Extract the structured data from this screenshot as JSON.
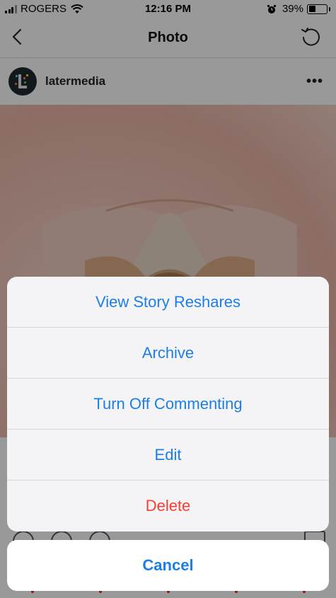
{
  "status_bar": {
    "carrier": "ROGERS",
    "time": "12:16 PM",
    "battery_text": "39%",
    "battery_level": 0.39
  },
  "nav": {
    "title": "Photo"
  },
  "post": {
    "username": "latermedia"
  },
  "action_sheet": {
    "items": [
      {
        "label": "View Story Reshares"
      },
      {
        "label": "Archive"
      },
      {
        "label": "Turn Off Commenting"
      },
      {
        "label": "Edit"
      },
      {
        "label": "Delete"
      }
    ],
    "cancel_label": "Cancel"
  },
  "colors": {
    "action_blue": "#1e7ee8",
    "destructive_red": "#ff3b30",
    "sheet_bg": "#f4f4f6"
  }
}
